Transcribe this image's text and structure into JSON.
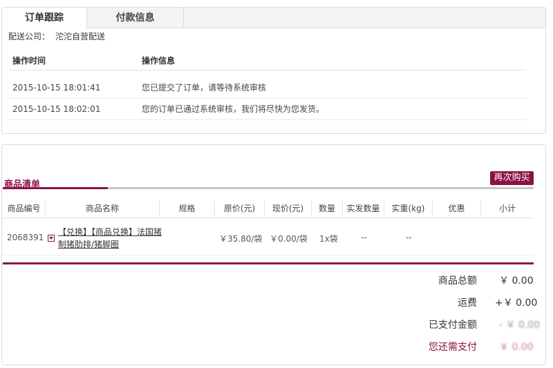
{
  "tabs": [
    {
      "label": "订单跟踪",
      "active": true
    },
    {
      "label": "付款信息",
      "active": false
    }
  ],
  "delivery": {
    "label": "配送公司：",
    "value": "沱沱自营配送"
  },
  "log": {
    "headers": [
      "操作时间",
      "操作信息"
    ],
    "rows": [
      {
        "time": "2015-10-15 18:01:41",
        "info": "您已提交了订单，请等待系统审核"
      },
      {
        "time": "2015-10-15 18:02:01",
        "info": "您的订单已通过系统审核，我们将尽快为您发货。"
      }
    ]
  },
  "goods": {
    "title": "商品清单",
    "rebuy_label": "再次购买",
    "headers": [
      "商品编号",
      "商品名称",
      "规格",
      "原价(元)",
      "现价(元)",
      "数量",
      "实发数量",
      "实重(kg)",
      "优惠",
      "小计"
    ],
    "rows": [
      {
        "id": "2068391",
        "name": "【兑换】【商品兑换】法国猪制猪肋排/猪脚圈",
        "spec": "",
        "orig_price": "￥35.80/袋",
        "cur_price": "￥0.00/袋",
        "qty": "1x袋",
        "shipped_qty": "--",
        "weight": "--",
        "discount": "",
        "subtotal": ""
      }
    ]
  },
  "summary": {
    "goods_total_label": "商品总额",
    "goods_total_value": "￥ 0.00",
    "shipping_label": "运费",
    "shipping_value": "+￥ 0.00",
    "paid_label": "已支付金额",
    "paid_value": "- ￥ 0.00",
    "due_label": "您还需支付",
    "due_value": "￥ 0.00"
  },
  "colors": {
    "accent": "#8a1244",
    "rule_gray": "#c8c8c8"
  }
}
